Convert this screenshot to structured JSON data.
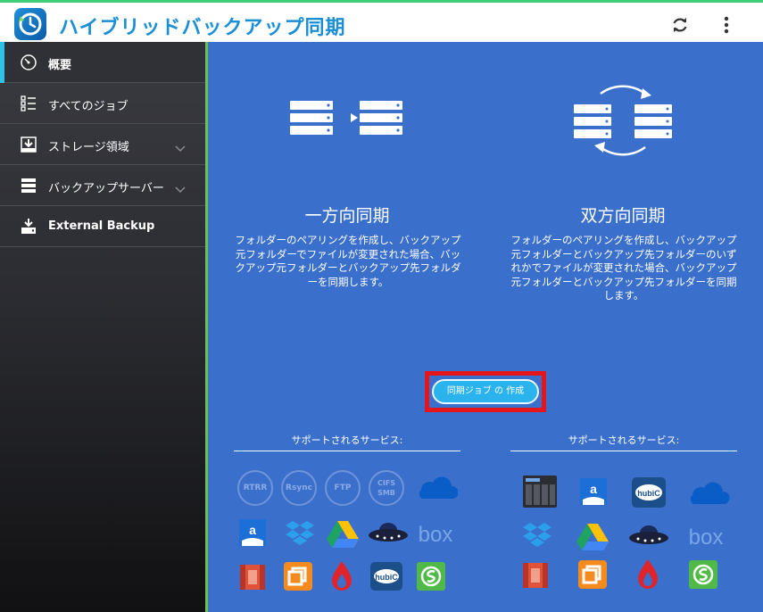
{
  "header": {
    "app_title": "ハイブリッドバックアップ同期",
    "icons": [
      "app-logo",
      "refresh-icon",
      "more-vertical-icon"
    ]
  },
  "sidebar": {
    "items": [
      {
        "label": "概要",
        "icon": "dashboard-gauge-icon",
        "active": true
      },
      {
        "label": "すべてのジョブ",
        "icon": "job-list-icon",
        "active": false
      },
      {
        "label": "ストレージ領域",
        "icon": "storage-download-icon",
        "active": false,
        "expandable": true
      },
      {
        "label": "バックアップサーバー",
        "icon": "server-stack-icon",
        "active": false,
        "expandable": true
      },
      {
        "label": "External Backup",
        "icon": "external-backup-icon",
        "active": false
      }
    ]
  },
  "main": {
    "one_way": {
      "title": "一方向同期",
      "description": "フォルダーのペアリングを作成し、バックアップ元フォルダーでファイルが変更された場合、バックアップ元フォルダーとバックアップ先フォルダーを同期します。",
      "services_title": "サポートされるサービス:",
      "services": [
        "RTRR",
        "Rsync",
        "FTP",
        "CIFS SMB",
        "OneDrive",
        "Amazon Drive",
        "Dropbox",
        "Google Drive",
        "Hubic UFO",
        "Box",
        "Amazon S3",
        "Office 365",
        "Backblaze",
        "hubiC",
        "ShareFile"
      ]
    },
    "two_way": {
      "title": "双方向同期",
      "description": "フォルダーのペアリングを作成し、バックアップ元フォルダーとバックアップ先フォルダーのいずれかでファイルが変更された場合、バックアップ元フォルダーとバックアップ先フォルダーを同期します。",
      "services_title": "サポートされるサービス:",
      "services": [
        "NAS",
        "Amazon Drive",
        "hubiC",
        "OneDrive",
        "Dropbox",
        "Google Drive",
        "Hubic UFO",
        "Box",
        "Amazon S3",
        "Office 365",
        "Backblaze",
        "ShareFile"
      ]
    },
    "create_button_label": "同期ジョブ の 作成"
  },
  "colors": {
    "main_bg": "#3b6fcc",
    "accent": "#2ab3ec",
    "highlight": "#e6151a",
    "header_title": "#1a8fd6"
  }
}
